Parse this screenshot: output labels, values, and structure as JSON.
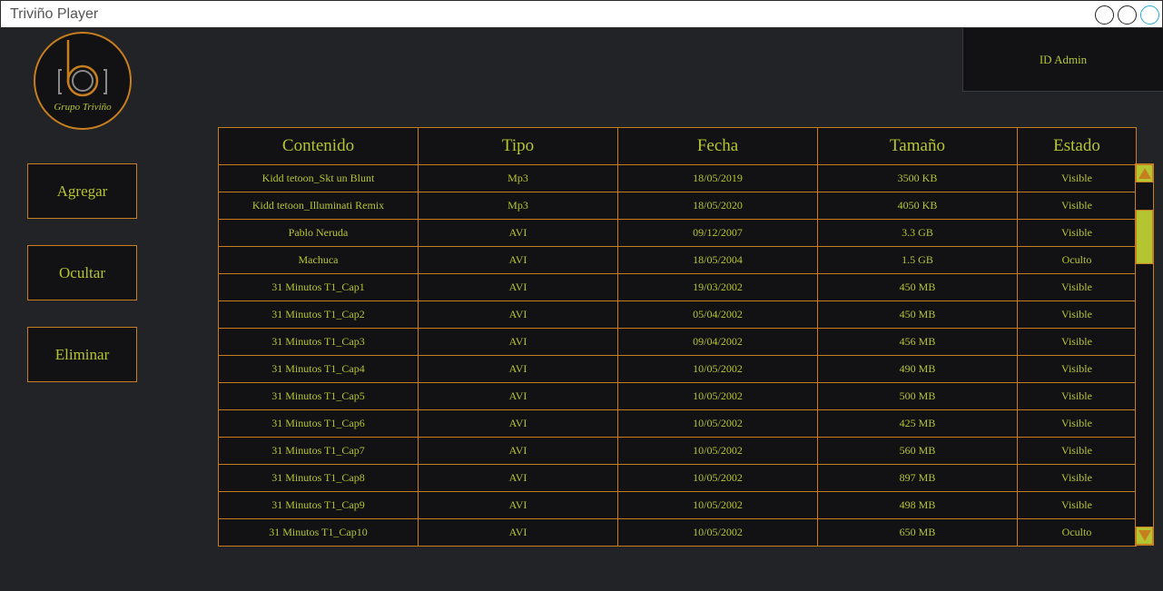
{
  "window": {
    "title": "Triviño Player"
  },
  "logo": {
    "text": "Grupo Triviño"
  },
  "admin": {
    "label": "ID Admin"
  },
  "sidebar": {
    "add_label": "Agregar",
    "hide_label": "Ocultar",
    "delete_label": "Eliminar"
  },
  "table": {
    "headers": [
      "Contenido",
      "Tipo",
      "Fecha",
      "Tamaño",
      "Estado"
    ],
    "rows": [
      [
        "Kidd tetoon_Skt un Blunt",
        "Mp3",
        "18/05/2019",
        "3500 KB",
        "Visible"
      ],
      [
        "Kidd tetoon_Illuminati Remix",
        "Mp3",
        "18/05/2020",
        "4050 KB",
        "Visible"
      ],
      [
        "Pablo Neruda",
        "AVI",
        "09/12/2007",
        "3.3 GB",
        "Visible"
      ],
      [
        "Machuca",
        "AVI",
        "18/05/2004",
        "1.5 GB",
        "Oculto"
      ],
      [
        "31 Minutos T1_Cap1",
        "AVI",
        "19/03/2002",
        "450 MB",
        "Visible"
      ],
      [
        "31 Minutos T1_Cap2",
        "AVI",
        "05/04/2002",
        "450 MB",
        "Visible"
      ],
      [
        "31 Minutos T1_Cap3",
        "AVI",
        "09/04/2002",
        "456 MB",
        "Visible"
      ],
      [
        "31 Minutos T1_Cap4",
        "AVI",
        "10/05/2002",
        "490 MB",
        "Visible"
      ],
      [
        "31 Minutos T1_Cap5",
        "AVI",
        "10/05/2002",
        "500 MB",
        "Visible"
      ],
      [
        "31 Minutos T1_Cap6",
        "AVI",
        "10/05/2002",
        "425 MB",
        "Visible"
      ],
      [
        "31 Minutos T1_Cap7",
        "AVI",
        "10/05/2002",
        "560 MB",
        "Visible"
      ],
      [
        "31 Minutos T1_Cap8",
        "AVI",
        "10/05/2002",
        "897 MB",
        "Visible"
      ],
      [
        "31 Minutos T1_Cap9",
        "AVI",
        "10/05/2002",
        "498 MB",
        "Visible"
      ],
      [
        "31 Minutos T1_Cap10",
        "AVI",
        "10/05/2002",
        "650 MB",
        "Oculto"
      ]
    ]
  },
  "colors": {
    "background": "#222327",
    "panel": "#121214",
    "accent_orange": "#c67e1e",
    "accent_lime": "#b5c531"
  },
  "icons": {
    "window_buttons": [
      "minimize-circle-icon",
      "maximize-circle-icon",
      "close-circle-icon"
    ],
    "scroll_up": "triangle-up-icon",
    "scroll_down": "triangle-down-icon",
    "logo": "camera-note-logo"
  }
}
